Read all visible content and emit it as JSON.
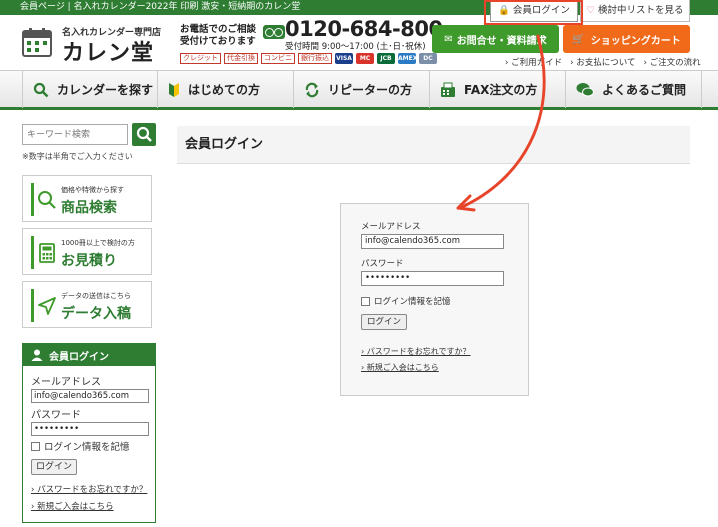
{
  "topbar": {
    "text": "会員ページ | 名入れカレンダー2022年 印刷 激安・短納期のカレン堂"
  },
  "logo": {
    "small": "名入れカレンダー専門店",
    "big": "カレン堂"
  },
  "phone": {
    "lead_line1": "お電話でのご相談",
    "lead_line2": "受付けております",
    "number": "0120-684-800",
    "hours": "受付時間 9:00～17:00 (土･日･祝休)"
  },
  "payments": {
    "items": [
      "クレジット",
      "代金引換",
      "コンビニ",
      "銀行振込"
    ],
    "cards": [
      "VISA",
      "MC",
      "JCB",
      "AMEX",
      "DC"
    ]
  },
  "header_buttons": {
    "member_login": "会員ログイン",
    "wishlist": "検討中リストを見る",
    "contact": "お問合せ・資料請求",
    "cart": "ショッピングカート"
  },
  "header_links": [
    "› ご利用ガイド",
    "› お支払について",
    "› ご注文の流れ"
  ],
  "nav": {
    "items": [
      {
        "label": "カレンダーを探す",
        "icon": "search-icon"
      },
      {
        "label": "はじめての方",
        "icon": "beginner-mark-icon"
      },
      {
        "label": "リピーターの方",
        "icon": "repeat-icon"
      },
      {
        "label": "FAX注文の方",
        "icon": "fax-icon"
      },
      {
        "label": "よくあるご質問",
        "icon": "chat-icon"
      }
    ]
  },
  "sidebar": {
    "search_placeholder": "キーワード検索",
    "search_note": "※数字は半角でご入力ください",
    "cards": [
      {
        "small": "価格や特徴から探す",
        "big": "商品検索",
        "icon": "search-icon"
      },
      {
        "small": "1000冊以上で検討の方",
        "big": "お見積り",
        "icon": "calculator-icon"
      },
      {
        "small": "データの送信はこちら",
        "big": "データ入稿",
        "icon": "send-icon"
      }
    ],
    "login": {
      "title": "会員ログイン",
      "email_label": "メールアドレス",
      "email_value": "info@calendo365.com",
      "password_label": "パスワード",
      "password_value": "•••••••••",
      "remember_label": "ログイン情報を記憶",
      "button": "ログイン",
      "forgot_link": "› パスワードをお忘れですか？",
      "register_link": "› 新規ご入会はこちら"
    }
  },
  "main": {
    "title": "会員ログイン",
    "login": {
      "email_label": "メールアドレス",
      "email_value": "info@calendo365.com",
      "password_label": "パスワード",
      "password_value": "•••••••••",
      "remember_label": "ログイン情報を記憶",
      "button": "ログイン",
      "forgot_link": "› パスワードをお忘れですか？",
      "register_link": "› 新規ご入会はこちら"
    }
  },
  "colors": {
    "brand_green": "#2e7d32",
    "cta_green": "#3f9a2c",
    "cta_orange": "#f06a1a",
    "annotation_red": "#e8442a"
  }
}
